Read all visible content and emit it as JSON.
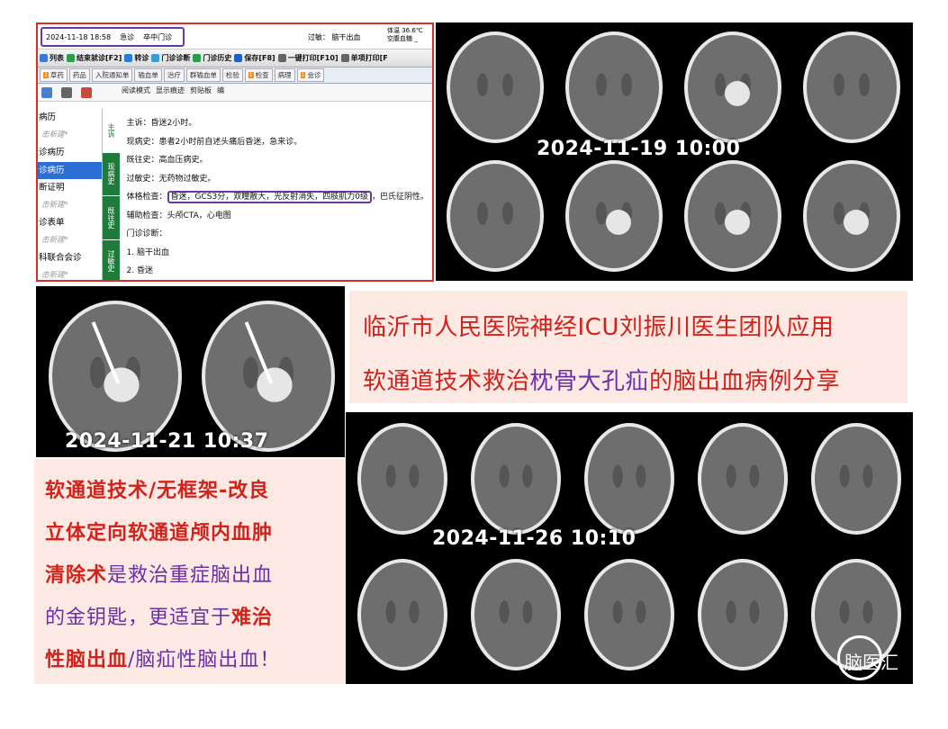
{
  "emr": {
    "visit_datetime": "2024-11-18 18:58",
    "visit_type": "急诊",
    "clinic": "卒中门诊",
    "prelim_dx": "过敏：  脑干出血",
    "vitals_line1": "体温 36.6℃",
    "vitals_line2": "空腹血糖 _",
    "toolbar": [
      {
        "label": "列表",
        "color": "#3a7bd5"
      },
      {
        "label": "结束就诊[F2]",
        "color": "#2a9d4f"
      },
      {
        "label": "转诊",
        "color": "#2a7fd5"
      },
      {
        "label": "门诊诊断",
        "color": "#3a9ad5"
      },
      {
        "label": "门诊历史",
        "color": "#2a9d4f"
      },
      {
        "label": "保存[F8]",
        "color": "#1f5fc7"
      },
      {
        "label": "一键打印[F10]",
        "color": "#666666"
      },
      {
        "label": "单项打印[F",
        "color": "#666666"
      }
    ],
    "tabs": [
      {
        "label": "草药",
        "badge": "2"
      },
      {
        "label": "药品",
        "badge": ""
      },
      {
        "label": "入院通知单",
        "badge": ""
      },
      {
        "label": "输血单",
        "badge": ""
      },
      {
        "label": "治疗",
        "badge": ""
      },
      {
        "label": "群输血单",
        "badge": ""
      },
      {
        "label": "检验",
        "badge": ""
      },
      {
        "label": "检查",
        "badge": "1"
      },
      {
        "label": "病理",
        "badge": ""
      },
      {
        "label": "会诊",
        "badge": "1"
      }
    ],
    "edit_tools": [
      "阅读模式",
      "显示痕迹",
      "剪贴板",
      "编"
    ],
    "nav_items": [
      {
        "label": "病历",
        "kind": "normal"
      },
      {
        "label": "击新建*",
        "kind": "sub"
      },
      {
        "label": "诊病历",
        "kind": "normal"
      },
      {
        "label": "诊病历",
        "kind": "sel"
      },
      {
        "label": "断证明",
        "kind": "normal"
      },
      {
        "label": "击新建*",
        "kind": "sub"
      },
      {
        "label": "诊表单",
        "kind": "normal"
      },
      {
        "label": "击新建*",
        "kind": "sub"
      },
      {
        "label": "科联合会诊",
        "kind": "normal"
      },
      {
        "label": "击新建*",
        "kind": "sub"
      }
    ],
    "vtabs": [
      "主诉",
      "现病史",
      "既往史",
      "过敏史"
    ],
    "note": {
      "chief": "主诉：昏迷2小时。",
      "hpi": "现病史：患者2小时前自述头痛后昏迷，急来诊。",
      "pmh": "既往史：高血压病史。",
      "allergy": "过敏史：无药物过敏史。",
      "exam_label": "体格检查：",
      "exam_boxed": "昏迷，GCS3分，双瞳散大，光反射消失，四肢肌力0级",
      "exam_tail": "，巴氏征阴性。",
      "aux": "辅助检查：头颅CTA，心电图",
      "dx_label": "门诊诊断：",
      "dx1": "1. 脑干出血",
      "dx2": "2. 昏迷"
    }
  },
  "ct_timestamps": {
    "t1": "2024-11-19 10:00",
    "t2": "2024-11-21 10:37",
    "t3": "2024-11-26 10:10"
  },
  "title": {
    "line1": "临沂市人民医院神经ICU刘振川医生团队应用",
    "line2_a": "软通道技术救治",
    "line2_b": "枕骨大孔疝",
    "line2_c": "的脑出血",
    "line2_d": "病例分享"
  },
  "desc": {
    "l1": "软通道技术/无框架-改良",
    "l2": "立体定向软通道颅内血肿",
    "l3_a": "清除术",
    "l3_b": "是救治重症脑出血",
    "l4_a": "的金钥匙，更适宜于",
    "l4_b": "难治",
    "l5_a": "性脑出血",
    "l5_b": "/脑疝性脑出血！"
  },
  "watermark": "脑医汇",
  "colors": {
    "red": "#d1221b",
    "purple": "#6b2fa8",
    "box_bg": "#fde9e3",
    "emr_border": "#d93025"
  }
}
